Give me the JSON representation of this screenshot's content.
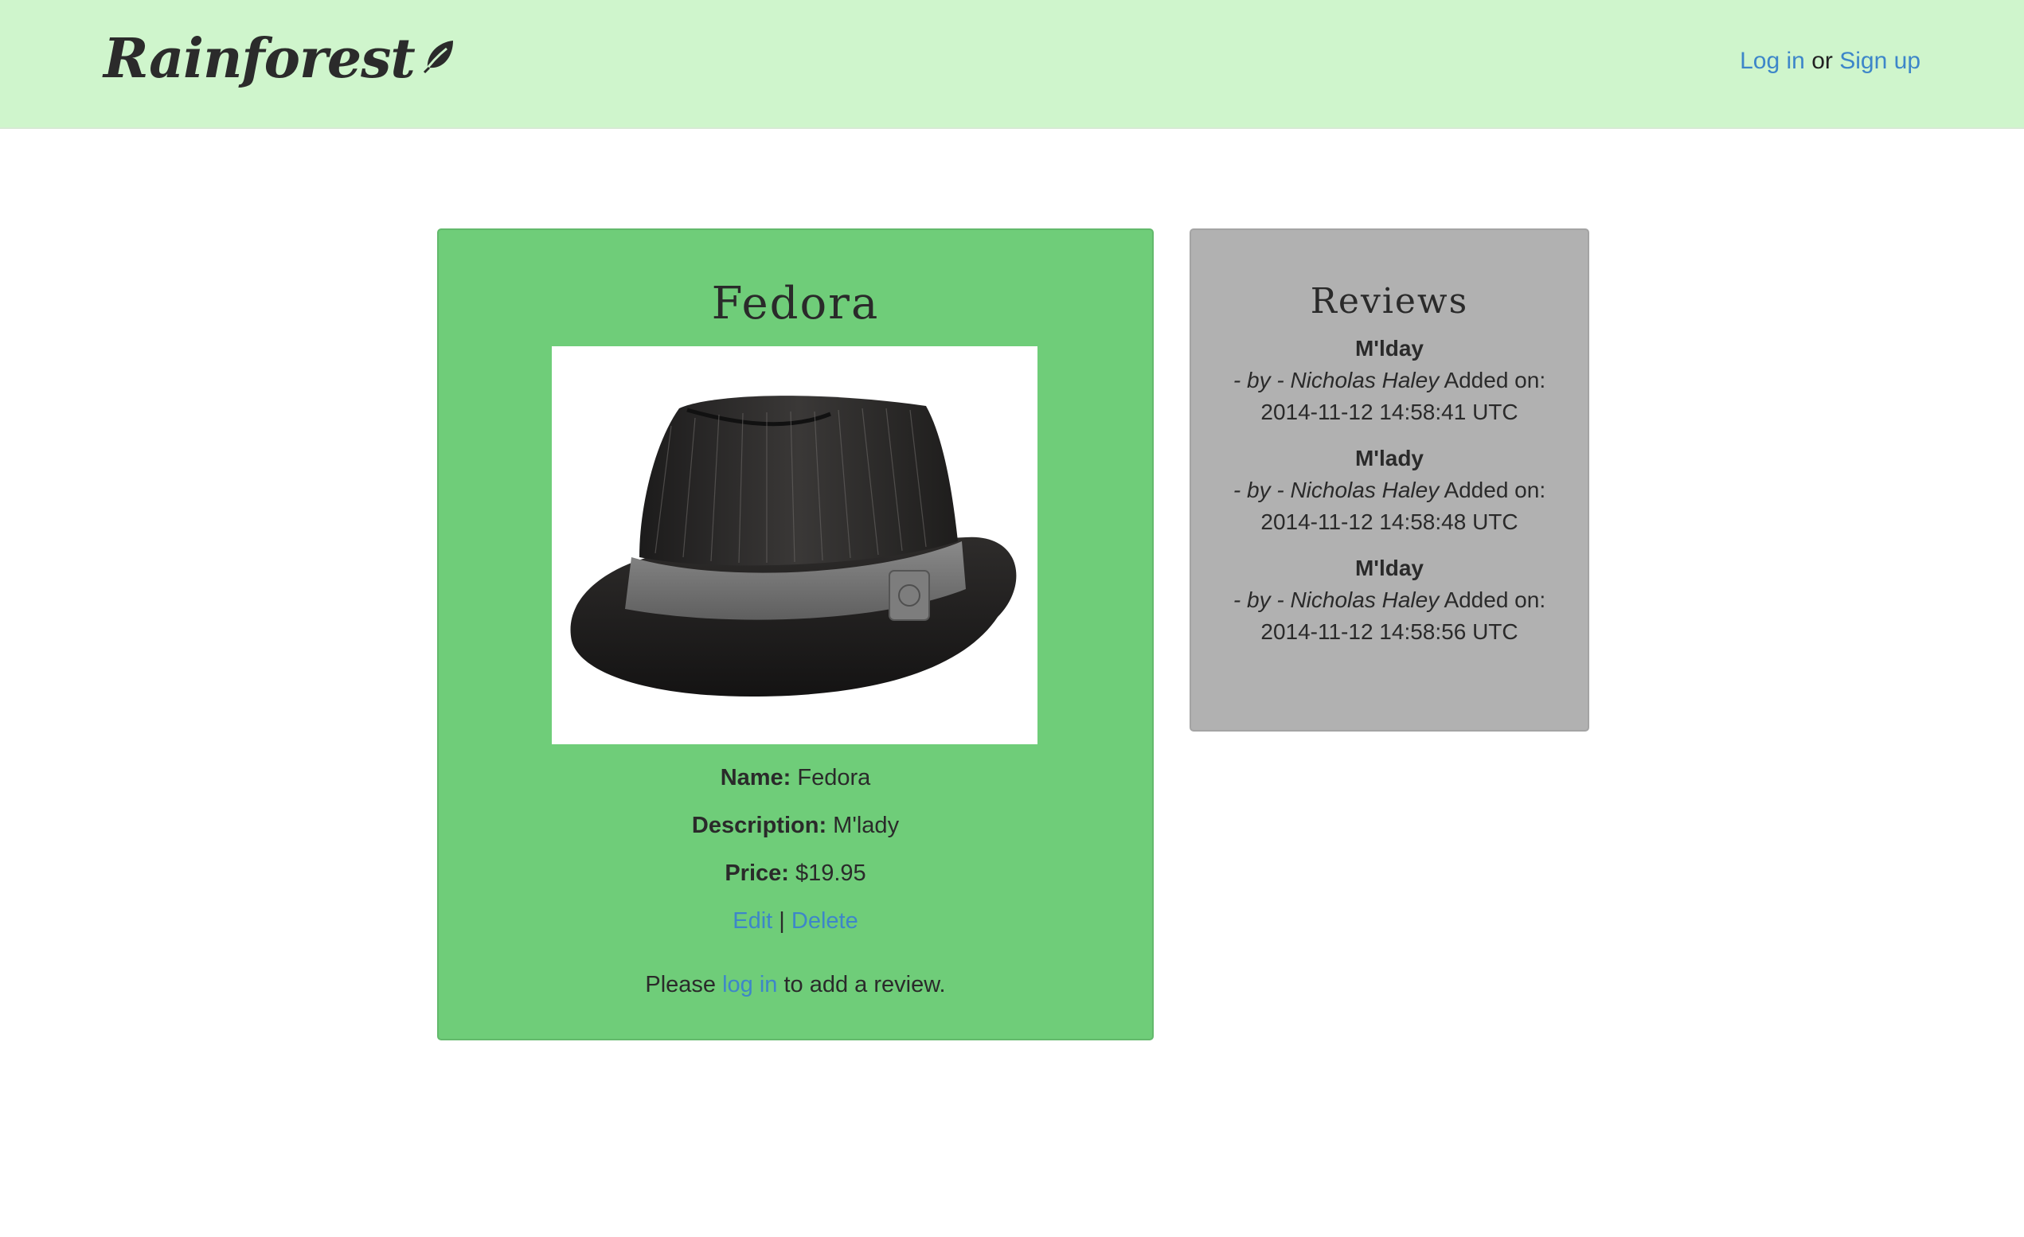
{
  "header": {
    "brand": "Rainforest",
    "login_label": "Log in",
    "or_text": "or",
    "signup_label": "Sign up"
  },
  "product": {
    "title": "Fedora",
    "name_label": "Name:",
    "name_value": "Fedora",
    "description_label": "Description:",
    "description_value": "M'lady",
    "price_label": "Price:",
    "price_value": "$19.95",
    "edit_label": "Edit",
    "separator": "|",
    "delete_label": "Delete",
    "prompt_before": "Please",
    "prompt_link": "log in",
    "prompt_after": "to add a review."
  },
  "reviews": {
    "title": "Reviews",
    "items": [
      {
        "title": "M'lday",
        "by": "- by - Nicholas Haley",
        "added_label": "Added on:",
        "date": "2014-11-12 14:58:41 UTC"
      },
      {
        "title": "M'lady",
        "by": "- by - Nicholas Haley",
        "added_label": "Added on:",
        "date": "2014-11-12 14:58:48 UTC"
      },
      {
        "title": "M'lday",
        "by": "- by - Nicholas Haley",
        "added_label": "Added on:",
        "date": "2014-11-12 14:58:56 UTC"
      }
    ]
  },
  "icons": {
    "brand_leaf": "leaf-icon"
  }
}
